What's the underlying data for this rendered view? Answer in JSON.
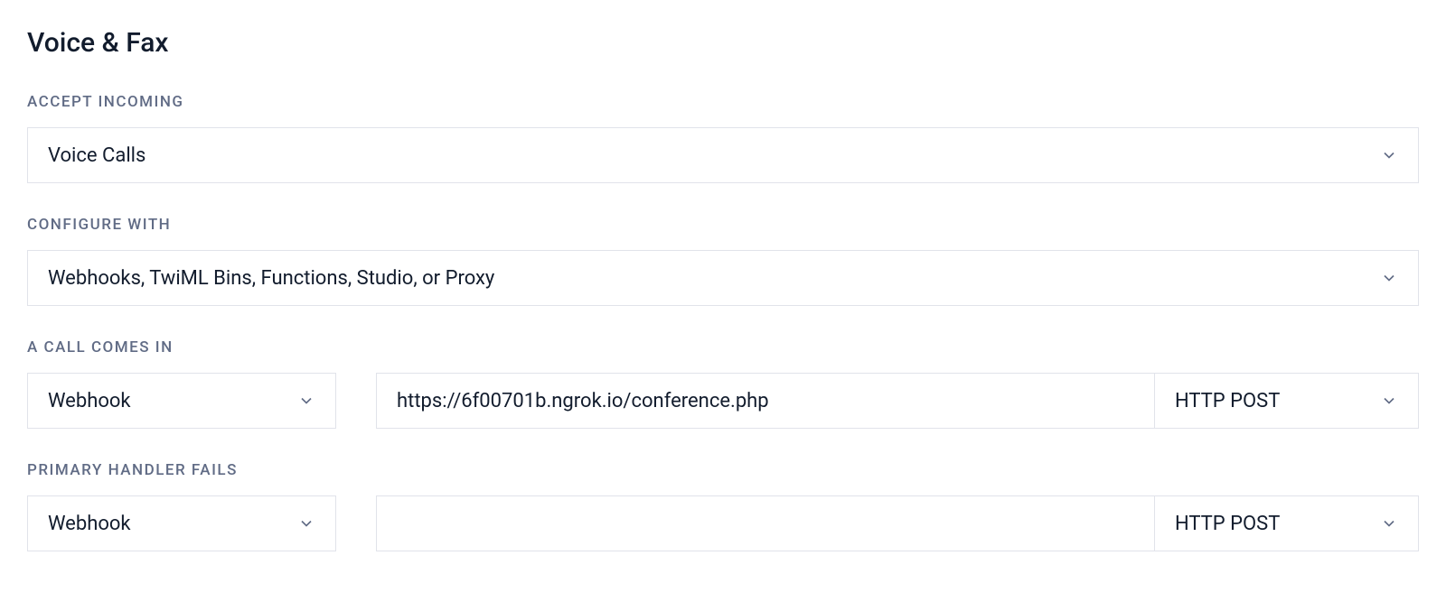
{
  "section": {
    "title": "Voice & Fax"
  },
  "accept_incoming": {
    "label": "ACCEPT INCOMING",
    "value": "Voice Calls"
  },
  "configure_with": {
    "label": "CONFIGURE WITH",
    "value": "Webhooks, TwiML Bins, Functions, Studio, or Proxy"
  },
  "call_comes_in": {
    "label": "A CALL COMES IN",
    "handler_type": "Webhook",
    "url": "https://6f00701b.ngrok.io/conference.php",
    "method": "HTTP POST"
  },
  "primary_handler_fails": {
    "label": "PRIMARY HANDLER FAILS",
    "handler_type": "Webhook",
    "url": "",
    "method": "HTTP POST"
  }
}
